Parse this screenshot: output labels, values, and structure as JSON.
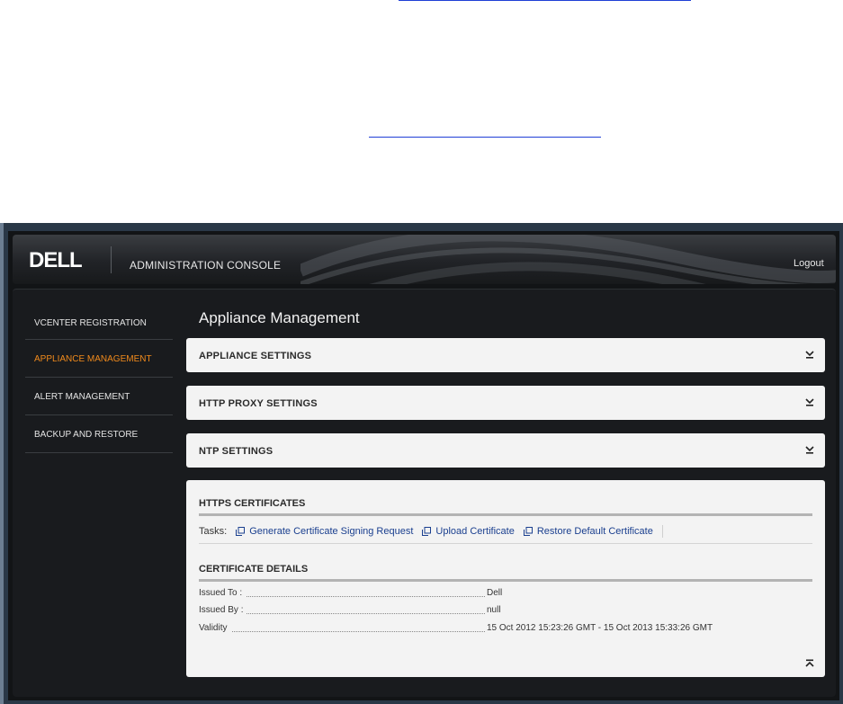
{
  "header": {
    "brand": "DELL",
    "console_title": "ADMINISTRATION CONSOLE",
    "logout_label": "Logout"
  },
  "sidebar": {
    "items": [
      {
        "label": "VCENTER REGISTRATION",
        "active": false
      },
      {
        "label": "APPLIANCE MANAGEMENT",
        "active": true
      },
      {
        "label": "ALERT MANAGEMENT",
        "active": false
      },
      {
        "label": "BACKUP AND RESTORE",
        "active": false
      }
    ]
  },
  "main": {
    "title": "Appliance Management",
    "sections": [
      {
        "title": "APPLIANCE SETTINGS",
        "icon": "expand-icon"
      },
      {
        "title": "HTTP PROXY SETTINGS",
        "icon": "expand-icon"
      },
      {
        "title": "NTP SETTINGS",
        "icon": "expand-icon"
      }
    ],
    "https": {
      "title": "HTTPS CERTIFICATES",
      "tasks_label": "Tasks:",
      "tasks": [
        "Generate Certificate Signing Request",
        "Upload Certificate",
        "Restore Default Certificate"
      ],
      "details_title": "CERTIFICATE DETAILS",
      "details": [
        {
          "label": "Issued To :",
          "value": "Dell"
        },
        {
          "label": "Issued By :",
          "value": "null"
        },
        {
          "label": "Validity",
          "value": "15 Oct 2012 15:23:26 GMT - 15 Oct 2013 15:33:26 GMT"
        }
      ]
    }
  },
  "colors": {
    "active_nav": "#f08a1c",
    "link": "#1a3f8f",
    "doc_link": "#1f3fd6"
  }
}
